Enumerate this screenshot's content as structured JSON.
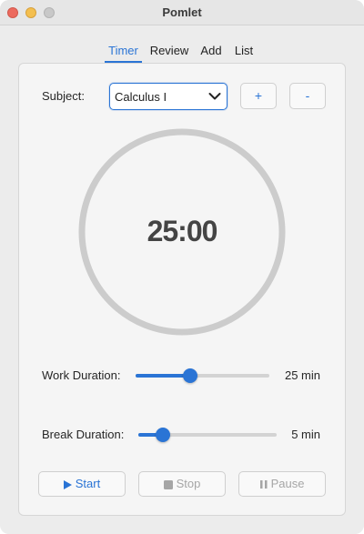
{
  "window": {
    "title": "Pomlet"
  },
  "tabs": [
    {
      "label": "Timer",
      "active": true
    },
    {
      "label": "Review",
      "active": false
    },
    {
      "label": "Add",
      "active": false
    },
    {
      "label": "List",
      "active": false
    }
  ],
  "subject": {
    "label": "Subject:",
    "selected": "Calculus I",
    "add_label": "+",
    "remove_label": "-"
  },
  "timer": {
    "display": "25:00"
  },
  "work": {
    "label": "Work Duration:",
    "value_text": "25 min",
    "level_percent": 41
  },
  "break": {
    "label": "Break Duration:",
    "value_text": "5 min",
    "level_percent": 18
  },
  "controls": {
    "start_label": "Start",
    "stop_label": "Stop",
    "pause_label": "Pause"
  },
  "colors": {
    "accent": "#2a74d5",
    "ring": "#cccccc",
    "disabled": "#a6a6a6"
  },
  "icons": {
    "start": "play-icon",
    "stop": "stop-square-icon",
    "pause": "pause-icon",
    "subject_dropdown": "chevron-down-icon"
  }
}
